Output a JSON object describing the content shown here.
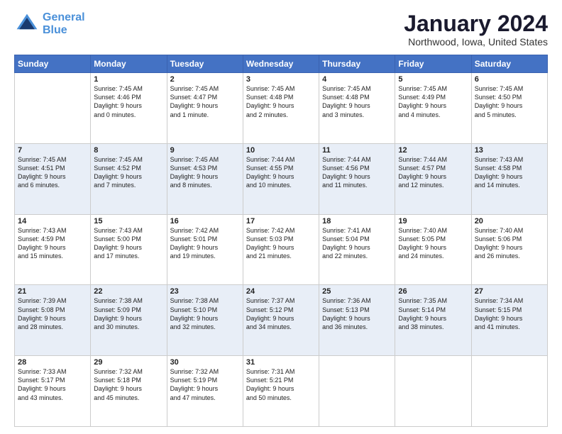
{
  "header": {
    "logo_line1": "General",
    "logo_line2": "Blue",
    "month": "January 2024",
    "location": "Northwood, Iowa, United States"
  },
  "days_of_week": [
    "Sunday",
    "Monday",
    "Tuesday",
    "Wednesday",
    "Thursday",
    "Friday",
    "Saturday"
  ],
  "weeks": [
    [
      {
        "day": "",
        "content": ""
      },
      {
        "day": "1",
        "content": "Sunrise: 7:45 AM\nSunset: 4:46 PM\nDaylight: 9 hours\nand 0 minutes."
      },
      {
        "day": "2",
        "content": "Sunrise: 7:45 AM\nSunset: 4:47 PM\nDaylight: 9 hours\nand 1 minute."
      },
      {
        "day": "3",
        "content": "Sunrise: 7:45 AM\nSunset: 4:48 PM\nDaylight: 9 hours\nand 2 minutes."
      },
      {
        "day": "4",
        "content": "Sunrise: 7:45 AM\nSunset: 4:48 PM\nDaylight: 9 hours\nand 3 minutes."
      },
      {
        "day": "5",
        "content": "Sunrise: 7:45 AM\nSunset: 4:49 PM\nDaylight: 9 hours\nand 4 minutes."
      },
      {
        "day": "6",
        "content": "Sunrise: 7:45 AM\nSunset: 4:50 PM\nDaylight: 9 hours\nand 5 minutes."
      }
    ],
    [
      {
        "day": "7",
        "content": "Sunrise: 7:45 AM\nSunset: 4:51 PM\nDaylight: 9 hours\nand 6 minutes."
      },
      {
        "day": "8",
        "content": "Sunrise: 7:45 AM\nSunset: 4:52 PM\nDaylight: 9 hours\nand 7 minutes."
      },
      {
        "day": "9",
        "content": "Sunrise: 7:45 AM\nSunset: 4:53 PM\nDaylight: 9 hours\nand 8 minutes."
      },
      {
        "day": "10",
        "content": "Sunrise: 7:44 AM\nSunset: 4:55 PM\nDaylight: 9 hours\nand 10 minutes."
      },
      {
        "day": "11",
        "content": "Sunrise: 7:44 AM\nSunset: 4:56 PM\nDaylight: 9 hours\nand 11 minutes."
      },
      {
        "day": "12",
        "content": "Sunrise: 7:44 AM\nSunset: 4:57 PM\nDaylight: 9 hours\nand 12 minutes."
      },
      {
        "day": "13",
        "content": "Sunrise: 7:43 AM\nSunset: 4:58 PM\nDaylight: 9 hours\nand 14 minutes."
      }
    ],
    [
      {
        "day": "14",
        "content": "Sunrise: 7:43 AM\nSunset: 4:59 PM\nDaylight: 9 hours\nand 15 minutes."
      },
      {
        "day": "15",
        "content": "Sunrise: 7:43 AM\nSunset: 5:00 PM\nDaylight: 9 hours\nand 17 minutes."
      },
      {
        "day": "16",
        "content": "Sunrise: 7:42 AM\nSunset: 5:01 PM\nDaylight: 9 hours\nand 19 minutes."
      },
      {
        "day": "17",
        "content": "Sunrise: 7:42 AM\nSunset: 5:03 PM\nDaylight: 9 hours\nand 21 minutes."
      },
      {
        "day": "18",
        "content": "Sunrise: 7:41 AM\nSunset: 5:04 PM\nDaylight: 9 hours\nand 22 minutes."
      },
      {
        "day": "19",
        "content": "Sunrise: 7:40 AM\nSunset: 5:05 PM\nDaylight: 9 hours\nand 24 minutes."
      },
      {
        "day": "20",
        "content": "Sunrise: 7:40 AM\nSunset: 5:06 PM\nDaylight: 9 hours\nand 26 minutes."
      }
    ],
    [
      {
        "day": "21",
        "content": "Sunrise: 7:39 AM\nSunset: 5:08 PM\nDaylight: 9 hours\nand 28 minutes."
      },
      {
        "day": "22",
        "content": "Sunrise: 7:38 AM\nSunset: 5:09 PM\nDaylight: 9 hours\nand 30 minutes."
      },
      {
        "day": "23",
        "content": "Sunrise: 7:38 AM\nSunset: 5:10 PM\nDaylight: 9 hours\nand 32 minutes."
      },
      {
        "day": "24",
        "content": "Sunrise: 7:37 AM\nSunset: 5:12 PM\nDaylight: 9 hours\nand 34 minutes."
      },
      {
        "day": "25",
        "content": "Sunrise: 7:36 AM\nSunset: 5:13 PM\nDaylight: 9 hours\nand 36 minutes."
      },
      {
        "day": "26",
        "content": "Sunrise: 7:35 AM\nSunset: 5:14 PM\nDaylight: 9 hours\nand 38 minutes."
      },
      {
        "day": "27",
        "content": "Sunrise: 7:34 AM\nSunset: 5:15 PM\nDaylight: 9 hours\nand 41 minutes."
      }
    ],
    [
      {
        "day": "28",
        "content": "Sunrise: 7:33 AM\nSunset: 5:17 PM\nDaylight: 9 hours\nand 43 minutes."
      },
      {
        "day": "29",
        "content": "Sunrise: 7:32 AM\nSunset: 5:18 PM\nDaylight: 9 hours\nand 45 minutes."
      },
      {
        "day": "30",
        "content": "Sunrise: 7:32 AM\nSunset: 5:19 PM\nDaylight: 9 hours\nand 47 minutes."
      },
      {
        "day": "31",
        "content": "Sunrise: 7:31 AM\nSunset: 5:21 PM\nDaylight: 9 hours\nand 50 minutes."
      },
      {
        "day": "",
        "content": ""
      },
      {
        "day": "",
        "content": ""
      },
      {
        "day": "",
        "content": ""
      }
    ]
  ]
}
